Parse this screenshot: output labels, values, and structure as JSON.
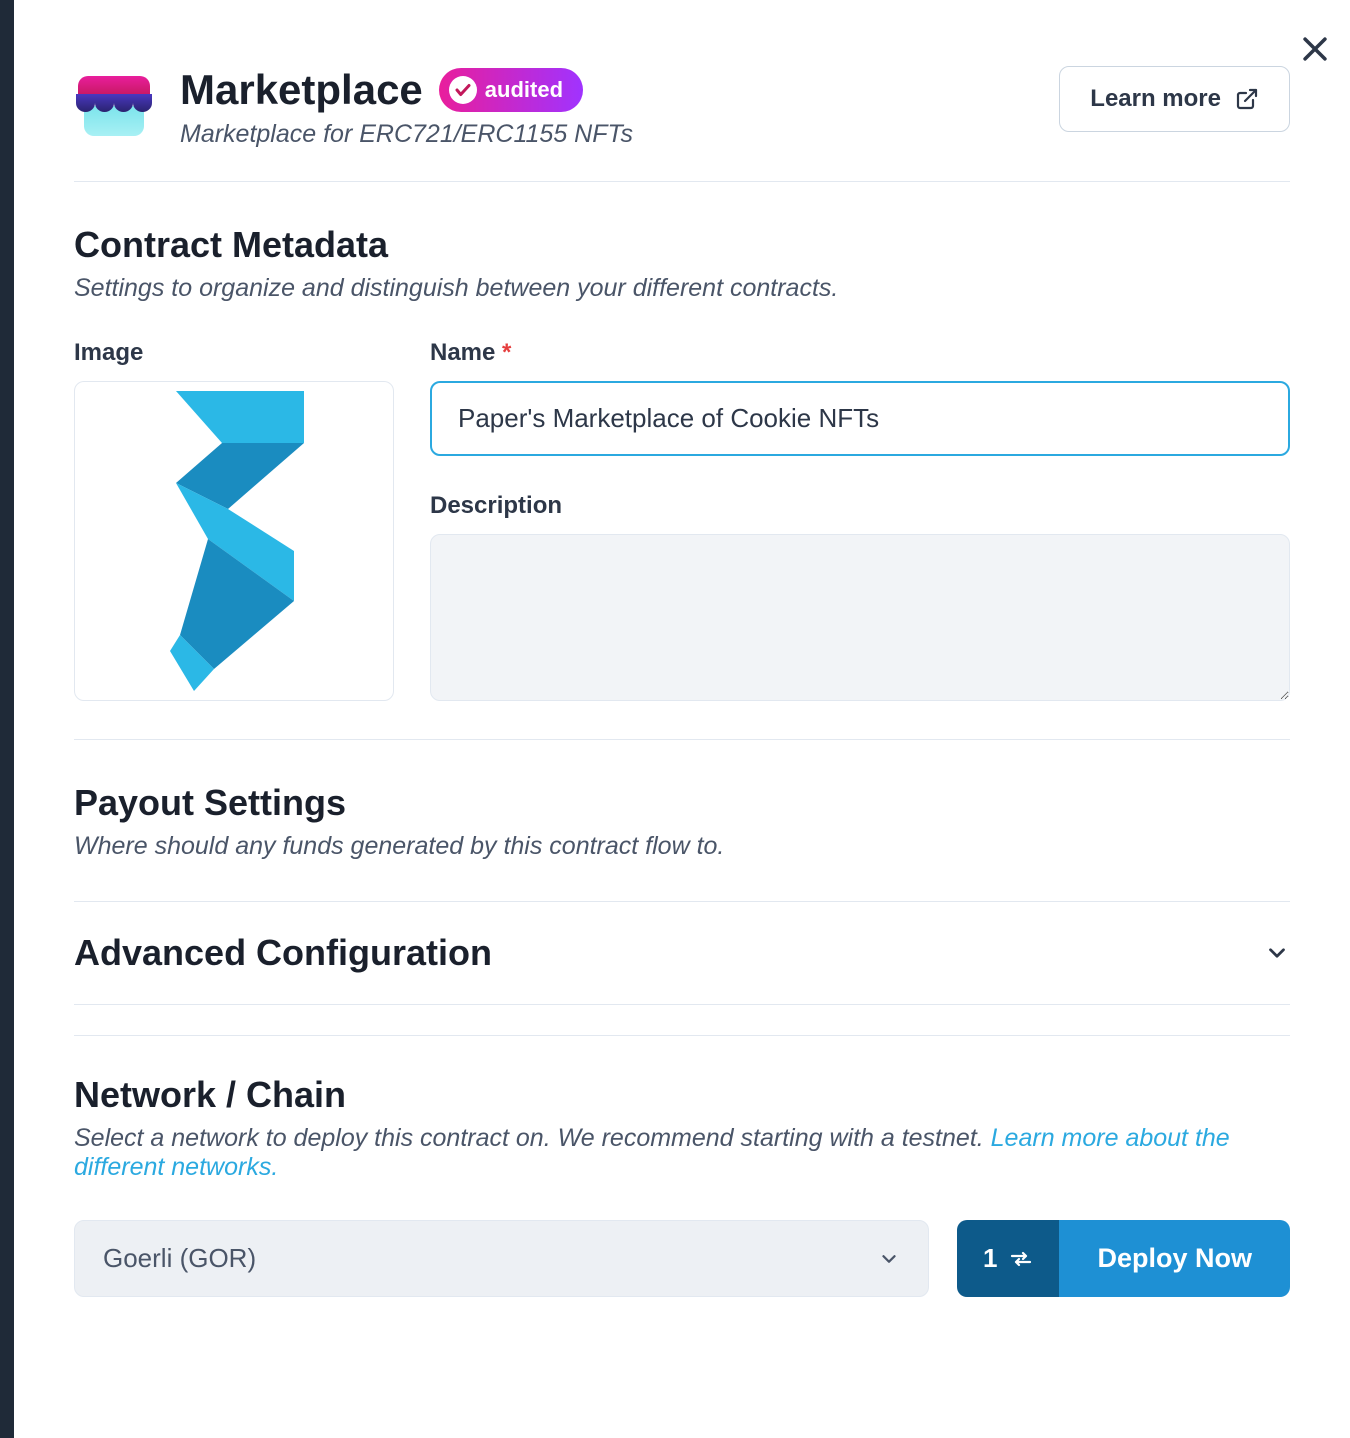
{
  "header": {
    "title": "Marketplace",
    "audited_label": "audited",
    "subtitle": "Marketplace for ERC721/ERC1155 NFTs",
    "learn_more": "Learn more"
  },
  "metadata": {
    "section_title": "Contract Metadata",
    "section_desc": "Settings to organize and distinguish between your different contracts.",
    "image_label": "Image",
    "name_label": "Name",
    "name_value": "Paper's Marketplace of Cookie NFTs",
    "description_label": "Description",
    "description_value": ""
  },
  "payout": {
    "section_title": "Payout Settings",
    "section_desc": "Where should any funds generated by this contract flow to."
  },
  "advanced": {
    "title": "Advanced Configuration"
  },
  "network": {
    "section_title": "Network / Chain",
    "section_desc_prefix": "Select a network to deploy this contract on. We recommend starting with a testnet. ",
    "section_desc_link": "Learn more about the different networks.",
    "selected": "Goerli (GOR)",
    "tx_count": "1",
    "deploy_label": "Deploy Now"
  }
}
